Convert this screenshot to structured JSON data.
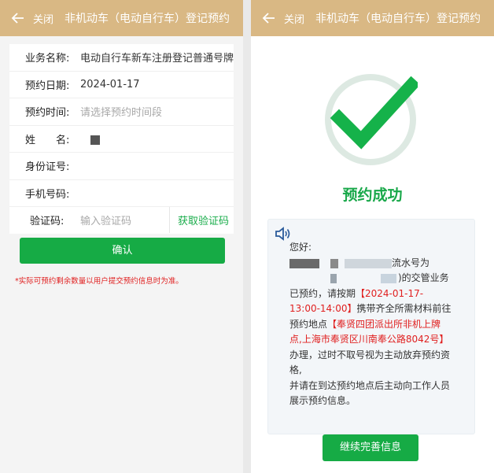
{
  "left": {
    "header": {
      "close": "关闭",
      "title": "非机动车（电动自行车）登记预约"
    },
    "form": {
      "business_label": "业务名称:",
      "business_value": "电动自行车新车注册登记普通号牌",
      "date_label": "预约日期:",
      "date_value": "2024-01-17",
      "time_label": "预约时间:",
      "time_placeholder": "请选择预约时间段",
      "name_label": "姓　　名:",
      "id_label": "身份证号:",
      "phone_label": "手机号码:",
      "code_label": "验证码:",
      "code_placeholder": "输入验证码",
      "get_code": "获取验证码"
    },
    "confirm": "确认",
    "notice": "*实际可预约剩余数量以用户提交预约信息时为准。"
  },
  "right": {
    "header": {
      "close": "关闭",
      "title": "非机动车（电动自行车）登记预约"
    },
    "success": "预约成功",
    "message": {
      "greeting": "您好:",
      "line1": "流水号为",
      "line2": ")的交管业务",
      "line3a": "已预约，请按期",
      "line3b": "【2024-01-17-",
      "line4a": "13:00-14:00】",
      "line4b": "携带齐全所需材料前往",
      "line5a": "预约地点",
      "line5b": "【奉贤四团派出所非机上牌",
      "line6": "点,上海市奉贤区川南奉公路8042号】",
      "line7": "办理，过时不取号视为主动放弃预约资格,",
      "line8": "并请在到达预约地点后主动向工作人员展示预约信息。"
    },
    "continue": "继续完善信息"
  },
  "colors": {
    "header": "#d9b884",
    "green": "#16ab45",
    "red": "#e02020"
  }
}
